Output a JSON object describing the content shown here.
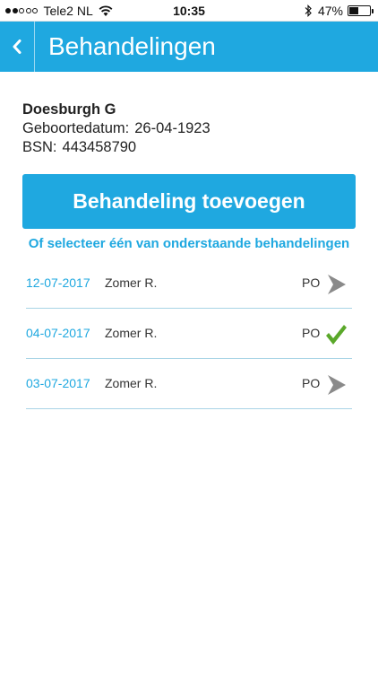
{
  "status_bar": {
    "carrier": "Tele2 NL",
    "time": "10:35",
    "battery": "47%",
    "battery_level": 0.47
  },
  "header": {
    "title": "Behandelingen"
  },
  "patient": {
    "name": "Doesburgh G",
    "birth_label": "Geboortedatum:",
    "birth_date": "26-04-1923",
    "bsn_label": "BSN:",
    "bsn": "443458790"
  },
  "add_button_label": "Behandeling toevoegen",
  "select_hint": "Of selecteer één van onderstaande behandelingen",
  "treatments": [
    {
      "date": "12-07-2017",
      "name": "Zomer R.",
      "type": "PO",
      "status": "chevron-right-icon"
    },
    {
      "date": "04-07-2017",
      "name": "Zomer R.",
      "type": "PO",
      "status": "checkmark-icon"
    },
    {
      "date": "03-07-2017",
      "name": "Zomer R.",
      "type": "PO",
      "status": "chevron-right-icon"
    }
  ],
  "colors": {
    "accent": "#1fa8e0",
    "check": "#5aa82a",
    "arrow": "#8a8a8a"
  }
}
